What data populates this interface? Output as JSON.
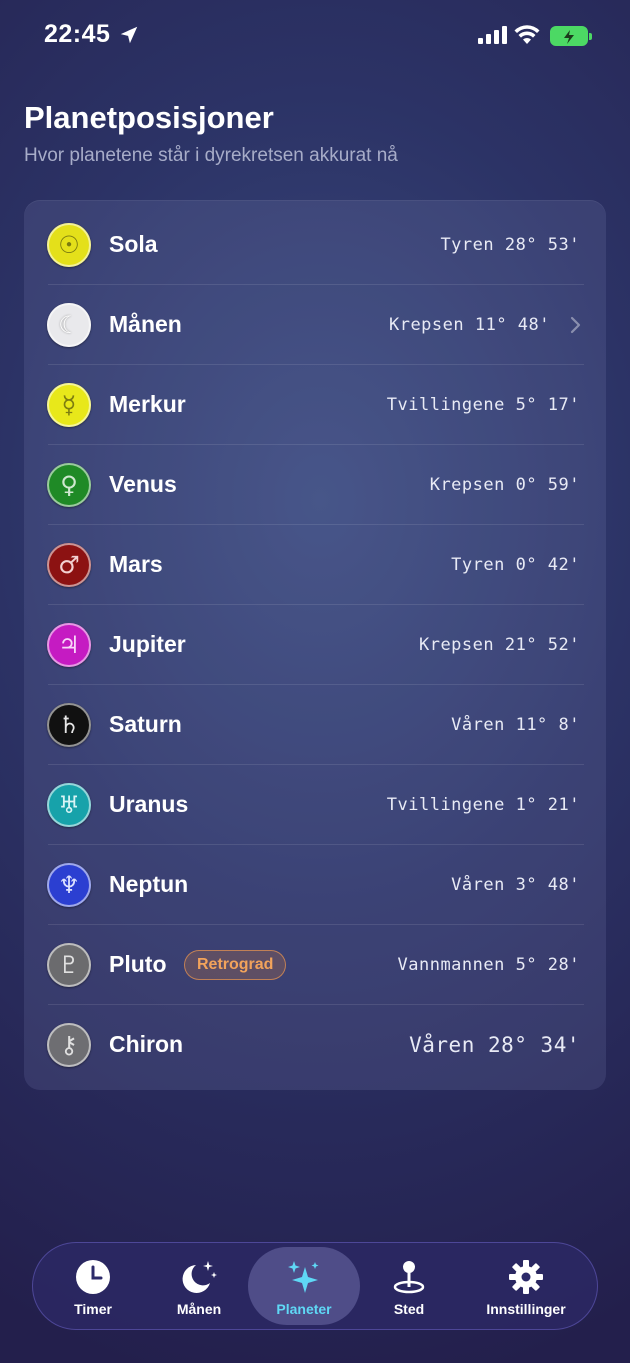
{
  "status_bar": {
    "time": "22:45"
  },
  "header": {
    "title": "Planetposisjoner",
    "subtitle": "Hvor planetene står i dyrekretsen akkurat nå"
  },
  "planets": [
    {
      "name": "Sola",
      "position": "Tyren 28° 53'",
      "symbol": "☉",
      "color": "#e4e01a",
      "icon": "sun-icon"
    },
    {
      "name": "Månen",
      "position": "Krepsen 11° 48'",
      "symbol": "☾",
      "color": "#e9e9ec",
      "icon": "moon-icon"
    },
    {
      "name": "Merkur",
      "position": "Tvillingene 5° 17'",
      "symbol": "☿",
      "color": "#e8e81a",
      "icon": "mercury-icon"
    },
    {
      "name": "Venus",
      "position": "Krepsen 0° 59'",
      "symbol": "♀",
      "color": "#1f8a26",
      "icon": "venus-icon"
    },
    {
      "name": "Mars",
      "position": "Tyren 0° 42'",
      "symbol": "♂",
      "color": "#8c1212",
      "icon": "mars-icon"
    },
    {
      "name": "Jupiter",
      "position": "Krepsen 21° 52'",
      "symbol": "♃",
      "color": "#c51bc2",
      "icon": "jupiter-icon"
    },
    {
      "name": "Saturn",
      "position": "Våren 11° 8'",
      "symbol": "♄",
      "color": "#111111",
      "icon": "saturn-icon"
    },
    {
      "name": "Uranus",
      "position": "Tvillingene 1° 21'",
      "symbol": "♅",
      "color": "#17a2aa",
      "icon": "uranus-icon"
    },
    {
      "name": "Neptun",
      "position": "Våren 3° 48'",
      "symbol": "♆",
      "color": "#2b3fd1",
      "icon": "neptune-icon"
    },
    {
      "name": "Pluto",
      "position": "Vannmannen 5° 28'",
      "symbol": "♇",
      "color": "#6b6b6e",
      "icon": "pluto-icon",
      "badge": "Retrograd"
    },
    {
      "name": "Chiron",
      "position": "Våren 28° 34'",
      "symbol": "⚷",
      "color": "#6e6e72",
      "icon": "chiron-icon"
    }
  ],
  "tabs": [
    {
      "label": "Timer",
      "icon": "clock-icon"
    },
    {
      "label": "Månen",
      "icon": "moon-stars-icon"
    },
    {
      "label": "Planeter",
      "icon": "sparkles-icon",
      "active": true
    },
    {
      "label": "Sted",
      "icon": "map-pin-icon"
    },
    {
      "label": "Innstillinger",
      "icon": "gear-icon"
    }
  ],
  "colors": {
    "accent": "#5fd8f5",
    "badge": "#f2a35b"
  }
}
